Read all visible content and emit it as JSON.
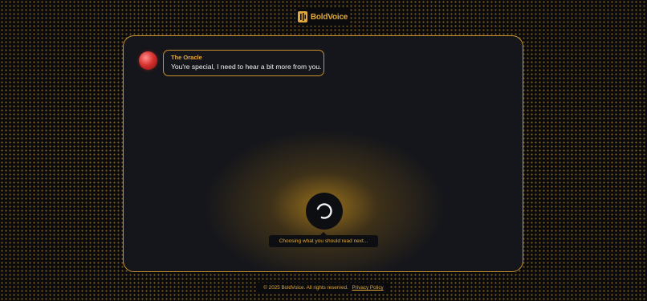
{
  "brand": {
    "name": "BoldVoice",
    "logo_icon": "boldvoice-logo-icon"
  },
  "chat": {
    "speaker": "The Oracle",
    "message": "You're special, I need to hear a bit more from you.",
    "avatar_icon": "red-orb-avatar"
  },
  "loading": {
    "status": "Choosing what you should read next...",
    "spinner_icon": "loading-spinner-icon"
  },
  "footer": {
    "copyright": "© 2025 BoldVoice. All rights reserved.",
    "privacy_link": "Privacy Policy"
  },
  "colors": {
    "accent": "#e0a93a",
    "panel_bg": "#15161b",
    "page_bg": "#0b0b0d",
    "text": "#f2f2f2"
  }
}
